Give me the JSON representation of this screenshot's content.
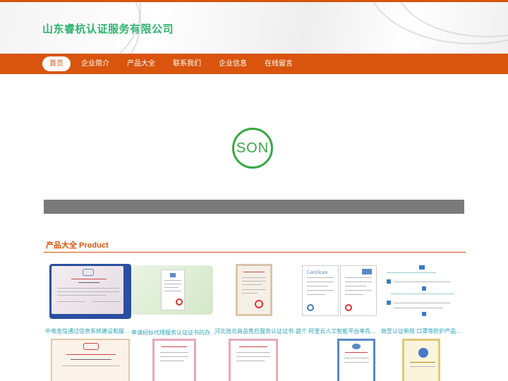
{
  "site": {
    "title": "山东睿杭认证服务有限公司"
  },
  "nav": {
    "items": [
      {
        "label": "首页",
        "active": true
      },
      {
        "label": "企业简介",
        "active": false
      },
      {
        "label": "产品大全",
        "active": false
      },
      {
        "label": "联系我们",
        "active": false
      },
      {
        "label": "企业信息",
        "active": false
      },
      {
        "label": "在线留言",
        "active": false
      }
    ]
  },
  "banner": {
    "logo_text": "SON"
  },
  "section": {
    "title": "产品大全 Product"
  },
  "products": [
    {
      "caption": "中电金信通过信息系统建设和服务..."
    },
    {
      "caption": "申请招标代理服务认证证书的办理..."
    },
    {
      "caption": "河北张北商品售后服务认证证书代办"
    },
    {
      "caption": "首个 阿里云人工智能平台率先通..."
    },
    {
      "caption": "政罡认证新规 口罩等防护产品除..."
    }
  ],
  "colors": {
    "accent": "#d9540c",
    "title": "#2db46e",
    "caption": "#2aa2b8",
    "logo": "#35a843"
  }
}
